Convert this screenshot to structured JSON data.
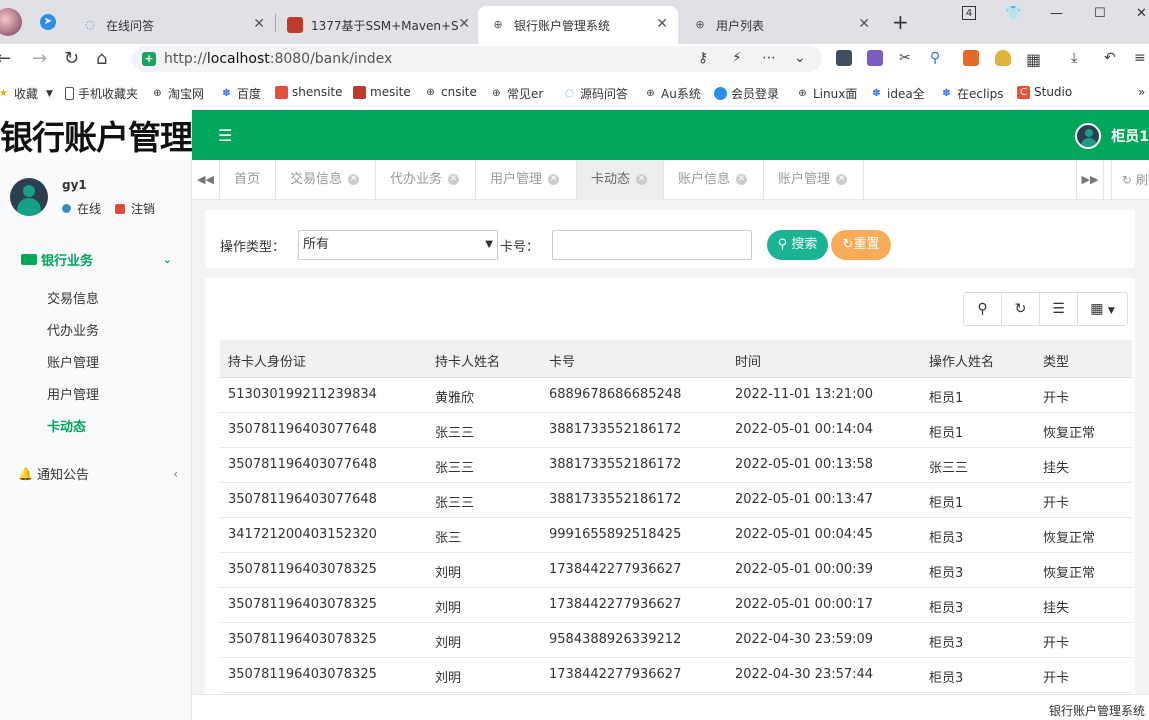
{
  "browser": {
    "tabs": [
      {
        "title": "在线问答",
        "icon": "qa-icon"
      },
      {
        "title": "1377基于SSM+Maven+S",
        "icon": "red-square-icon"
      },
      {
        "title": "银行账户管理系统",
        "icon": "globe-icon"
      },
      {
        "title": "用户列表",
        "icon": "globe-icon"
      }
    ],
    "tab_count_badge": "4",
    "url_prefix": "http://",
    "url_host": "localhost",
    "url_rest": ":8080/bank/index"
  },
  "bookmarks": [
    {
      "label": "收藏",
      "icon": "star-icon"
    },
    {
      "label": "手机收藏夹",
      "icon": "phone-icon"
    },
    {
      "label": "淘宝网",
      "icon": "globe-icon"
    },
    {
      "label": "百度",
      "icon": "paw-icon"
    },
    {
      "label": "shensite",
      "icon": "grid-icon"
    },
    {
      "label": "mesite",
      "icon": "red-square-icon"
    },
    {
      "label": "cnsite",
      "icon": "globe-icon"
    },
    {
      "label": "常见er",
      "icon": "globe-icon"
    },
    {
      "label": "源码问答",
      "icon": "qa-icon"
    },
    {
      "label": "Au系统",
      "icon": "globe-icon"
    },
    {
      "label": "会员登录",
      "icon": "cloud-icon"
    },
    {
      "label": "Linux面",
      "icon": "globe-icon"
    },
    {
      "label": "idea全",
      "icon": "paw-icon"
    },
    {
      "label": "在eclips",
      "icon": "paw-icon"
    },
    {
      "label": "Studio",
      "icon": "c-icon"
    }
  ],
  "app": {
    "logo_text": "银行账户管理系统",
    "top_user": "柜员1",
    "sidebar": {
      "user_name": "gy1",
      "online": "在线",
      "logout": "注销",
      "group": "银行业务",
      "items": [
        "交易信息",
        "代办业务",
        "账户管理",
        "用户管理",
        "卡动态"
      ],
      "notice": "通知公告"
    },
    "tabs": [
      "首页",
      "交易信息",
      "代办业务",
      "用户管理",
      "卡动态",
      "账户信息",
      "账户管理"
    ],
    "refresh": "刷新",
    "search": {
      "type_label": "操作类型：",
      "type_value": "所有",
      "card_label": "卡号：",
      "search_btn": "搜索",
      "reset_btn": "重置"
    },
    "table": {
      "headers": [
        "持卡人身份证",
        "持卡人姓名",
        "卡号",
        "时间",
        "操作人姓名",
        "类型"
      ],
      "rows": [
        [
          "513030199211239834",
          "黄雅欣",
          "6889678686685248",
          "2022-11-01 13:21:00",
          "柜员1",
          "开卡"
        ],
        [
          "350781196403077648",
          "张三三",
          "3881733552186172",
          "2022-05-01 00:14:04",
          "柜员1",
          "恢复正常"
        ],
        [
          "350781196403077648",
          "张三三",
          "3881733552186172",
          "2022-05-01 00:13:58",
          "张三三",
          "挂失"
        ],
        [
          "350781196403077648",
          "张三三",
          "3881733552186172",
          "2022-05-01 00:13:47",
          "柜员1",
          "开卡"
        ],
        [
          "341721200403152320",
          "张三",
          "9991655892518425",
          "2022-05-01 00:04:45",
          "柜员3",
          "恢复正常"
        ],
        [
          "350781196403078325",
          "刘明",
          "1738442277936627",
          "2022-05-01 00:00:39",
          "柜员3",
          "恢复正常"
        ],
        [
          "350781196403078325",
          "刘明",
          "1738442277936627",
          "2022-05-01 00:00:17",
          "柜员3",
          "挂失"
        ],
        [
          "350781196403078325",
          "刘明",
          "9584388926339212",
          "2022-04-30 23:59:09",
          "柜员3",
          "开卡"
        ],
        [
          "350781196403078325",
          "刘明",
          "1738442277936627",
          "2022-04-30 23:57:44",
          "柜员3",
          "开卡"
        ]
      ]
    },
    "footer": "银行账户管理系统"
  },
  "colors": {
    "brand_green": "#00a65a",
    "search_btn": "#1ab394",
    "reset_btn": "#f8ac59"
  }
}
